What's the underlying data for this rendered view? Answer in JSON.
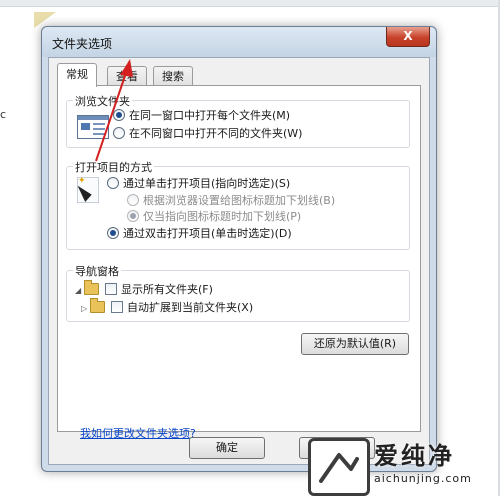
{
  "background": {
    "fragment_text": "c"
  },
  "dialog": {
    "title": "文件夹选项",
    "close_symbol": "X",
    "tabs": [
      {
        "label": "常规"
      },
      {
        "label": "查看"
      },
      {
        "label": "搜索"
      }
    ],
    "browse_group": {
      "title": "浏览文件夹",
      "options": [
        {
          "label": "在同一窗口中打开每个文件夹(M)",
          "checked": true
        },
        {
          "label": "在不同窗口中打开不同的文件夹(W)",
          "checked": false
        }
      ]
    },
    "open_group": {
      "title": "打开项目的方式",
      "options": [
        {
          "label": "通过单击打开项目(指向时选定)(S)",
          "checked": false
        },
        {
          "label": "根据浏览器设置给图标标题加下划线(B)",
          "checked": false
        },
        {
          "label": "仅当指向图标标题时加下划线(P)",
          "checked": true
        },
        {
          "label": "通过双击打开项目(单击时选定)(D)",
          "checked": true
        }
      ]
    },
    "nav_group": {
      "title": "导航窗格",
      "options": [
        {
          "label": "显示所有文件夹(F)",
          "checked": false
        },
        {
          "label": "自动扩展到当前文件夹(X)",
          "checked": false
        }
      ]
    },
    "restore_defaults_label": "还原为默认值(R)",
    "help_link": "我如何更改文件夹选项?",
    "ok_label": "确定",
    "cancel_label": "取"
  },
  "watermark": {
    "brand": "爱纯净",
    "url": "aichunjing.com"
  },
  "colors": {
    "annotation_arrow": "#d42020",
    "link": "#0645c9",
    "close_button": "#c7432a"
  }
}
